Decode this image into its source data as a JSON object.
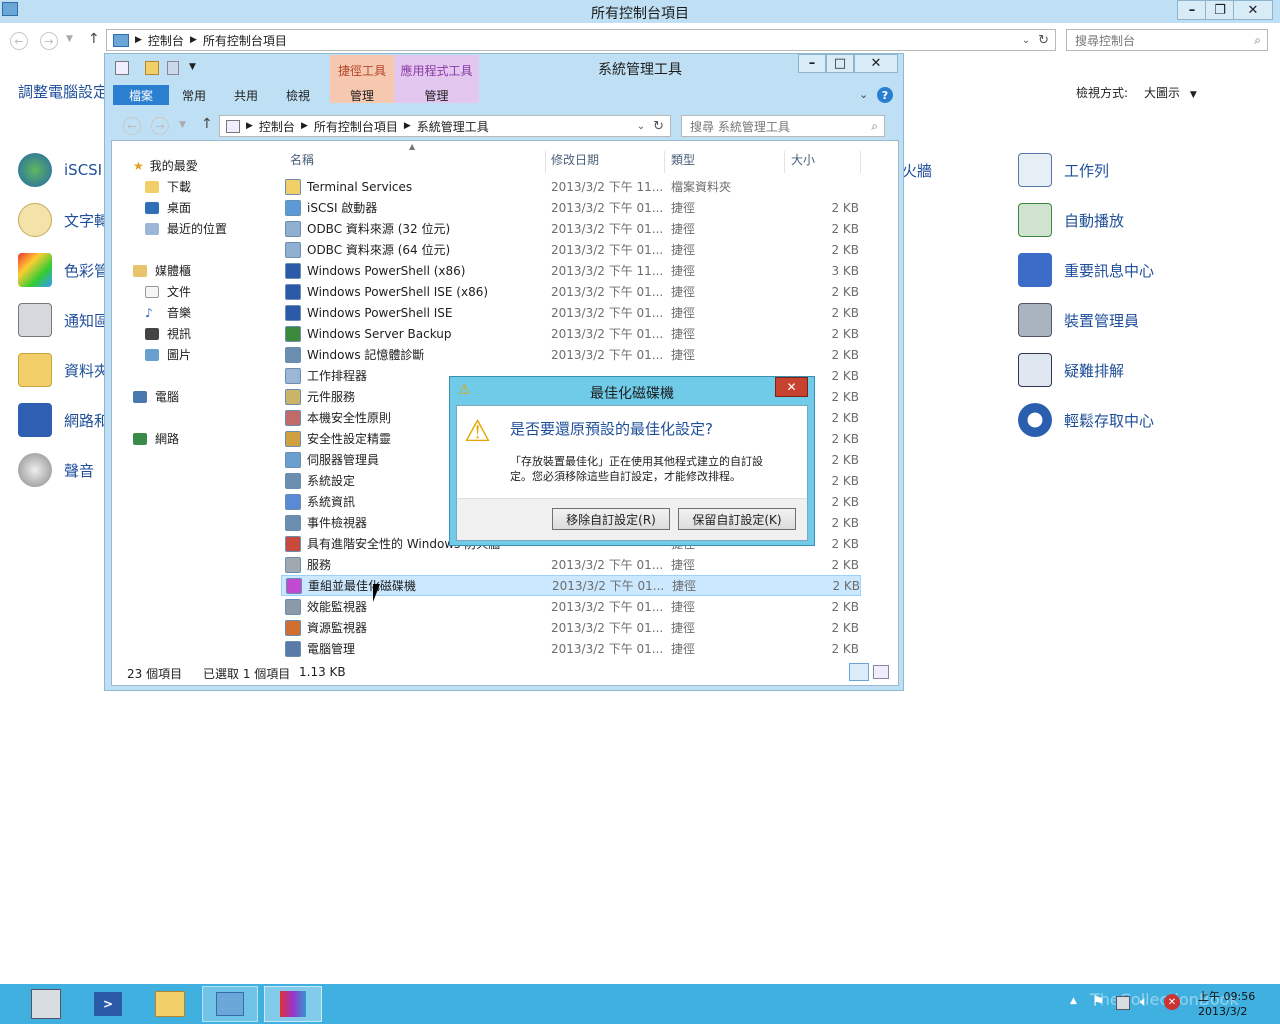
{
  "control_panel": {
    "title": "所有控制台項目",
    "breadcrumb": [
      "控制台",
      "所有控制台項目"
    ],
    "search_placeholder": "搜尋控制台",
    "heading": "調整電腦設定",
    "view_label": "檢視方式:",
    "view_value": "大圖示",
    "left_items": [
      "iSCSI",
      "文字轉",
      "色彩管",
      "通知區",
      "資料夾",
      "網路和",
      "聲音"
    ],
    "mid_items": [
      "火牆"
    ],
    "right_items": [
      "工作列",
      "自動播放",
      "重要訊息中心",
      "裝置管理員",
      "疑難排解",
      "輕鬆存取中心"
    ]
  },
  "explorer": {
    "title": "系統管理工具",
    "context_tabs": [
      "捷徑工具",
      "應用程式工具"
    ],
    "ribbon_tabs": [
      "檔案",
      "常用",
      "共用",
      "檢視",
      "管理",
      "管理"
    ],
    "breadcrumb": [
      "控制台",
      "所有控制台項目",
      "系統管理工具"
    ],
    "search_placeholder": "搜尋 系統管理工具",
    "columns": [
      "名稱",
      "修改日期",
      "類型",
      "大小"
    ],
    "nav": {
      "favorites": "我的最愛",
      "favorite_items": [
        "下載",
        "桌面",
        "最近的位置"
      ],
      "libraries": "媒體櫃",
      "library_items": [
        "文件",
        "音樂",
        "視訊",
        "圖片"
      ],
      "computer": "電腦",
      "network": "網路"
    },
    "files": [
      {
        "name": "Terminal Services",
        "date": "2013/3/2 下午 11...",
        "type": "檔案資料夾",
        "size": ""
      },
      {
        "name": "iSCSI 啟動器",
        "date": "2013/3/2 下午 01...",
        "type": "捷徑",
        "size": "2 KB"
      },
      {
        "name": "ODBC 資料來源 (32 位元)",
        "date": "2013/3/2 下午 01...",
        "type": "捷徑",
        "size": "2 KB"
      },
      {
        "name": "ODBC 資料來源 (64 位元)",
        "date": "2013/3/2 下午 01...",
        "type": "捷徑",
        "size": "2 KB"
      },
      {
        "name": "Windows PowerShell (x86)",
        "date": "2013/3/2 下午 11...",
        "type": "捷徑",
        "size": "3 KB"
      },
      {
        "name": "Windows PowerShell ISE (x86)",
        "date": "2013/3/2 下午 01...",
        "type": "捷徑",
        "size": "2 KB"
      },
      {
        "name": "Windows PowerShell ISE",
        "date": "2013/3/2 下午 01...",
        "type": "捷徑",
        "size": "2 KB"
      },
      {
        "name": "Windows Server Backup",
        "date": "2013/3/2 下午 01...",
        "type": "捷徑",
        "size": "2 KB"
      },
      {
        "name": "Windows 記憶體診斷",
        "date": "2013/3/2 下午 01...",
        "type": "捷徑",
        "size": "2 KB"
      },
      {
        "name": "工作排程器",
        "date": "",
        "type": "",
        "size": "2 KB"
      },
      {
        "name": "元件服務",
        "date": "",
        "type": "",
        "size": "2 KB"
      },
      {
        "name": "本機安全性原則",
        "date": "",
        "type": "",
        "size": "2 KB"
      },
      {
        "name": "安全性設定精靈",
        "date": "",
        "type": "",
        "size": "2 KB"
      },
      {
        "name": "伺服器管理員",
        "date": "",
        "type": "",
        "size": "2 KB"
      },
      {
        "name": "系統設定",
        "date": "",
        "type": "",
        "size": "2 KB"
      },
      {
        "name": "系統資訊",
        "date": "",
        "type": "",
        "size": "2 KB"
      },
      {
        "name": "事件檢視器",
        "date": "",
        "type": "",
        "size": "2 KB"
      },
      {
        "name": "具有進階安全性的 Windows 防火牆",
        "date": "",
        "type": "捷徑",
        "size": "2 KB"
      },
      {
        "name": "服務",
        "date": "2013/3/2 下午 01...",
        "type": "捷徑",
        "size": "2 KB"
      },
      {
        "name": "重組並最佳化磁碟機",
        "date": "2013/3/2 下午 01...",
        "type": "捷徑",
        "size": "2 KB"
      },
      {
        "name": "效能監視器",
        "date": "2013/3/2 下午 01...",
        "type": "捷徑",
        "size": "2 KB"
      },
      {
        "name": "資源監視器",
        "date": "2013/3/2 下午 01...",
        "type": "捷徑",
        "size": "2 KB"
      },
      {
        "name": "電腦管理",
        "date": "2013/3/2 下午 01...",
        "type": "捷徑",
        "size": "2 KB"
      }
    ],
    "selected_index": 19,
    "status_count": "23 個項目",
    "status_selected": "已選取 1 個項目",
    "status_size": "1.13 KB"
  },
  "dialog": {
    "title": "最佳化磁碟機",
    "question": "是否要還原預設的最佳化設定?",
    "message_line1": "「存放裝置最佳化」正在使用其他程式建立的自訂設",
    "message_line2": "定。您必須移除這些自訂設定，才能修改排程。",
    "remove_button": "移除自訂設定(R)",
    "keep_button": "保留自訂設定(K)"
  },
  "taskbar": {
    "time": "上午 09:56",
    "date": "2013/3/2",
    "watermark": "TheCollectionBook"
  },
  "colors": {
    "window_frame": "#bfe0f4",
    "dialog_frame": "#6fcbe8",
    "taskbar": "#3fb0e0",
    "file_tab": "#2a7fd0",
    "shortcut_tools_tab": "#f7c8b0",
    "app_tools_tab": "#e3c7ee",
    "selection": "#cce8ff",
    "link_text": "#1f4f99"
  },
  "icons": [
    "app-icon",
    "back-icon",
    "forward-icon",
    "up-icon",
    "refresh-icon",
    "search-icon",
    "warning-icon",
    "close-icon",
    "minimize-icon",
    "maximize-icon",
    "star-icon",
    "folder-icon",
    "help-icon",
    "flag-icon",
    "speaker-icon"
  ]
}
